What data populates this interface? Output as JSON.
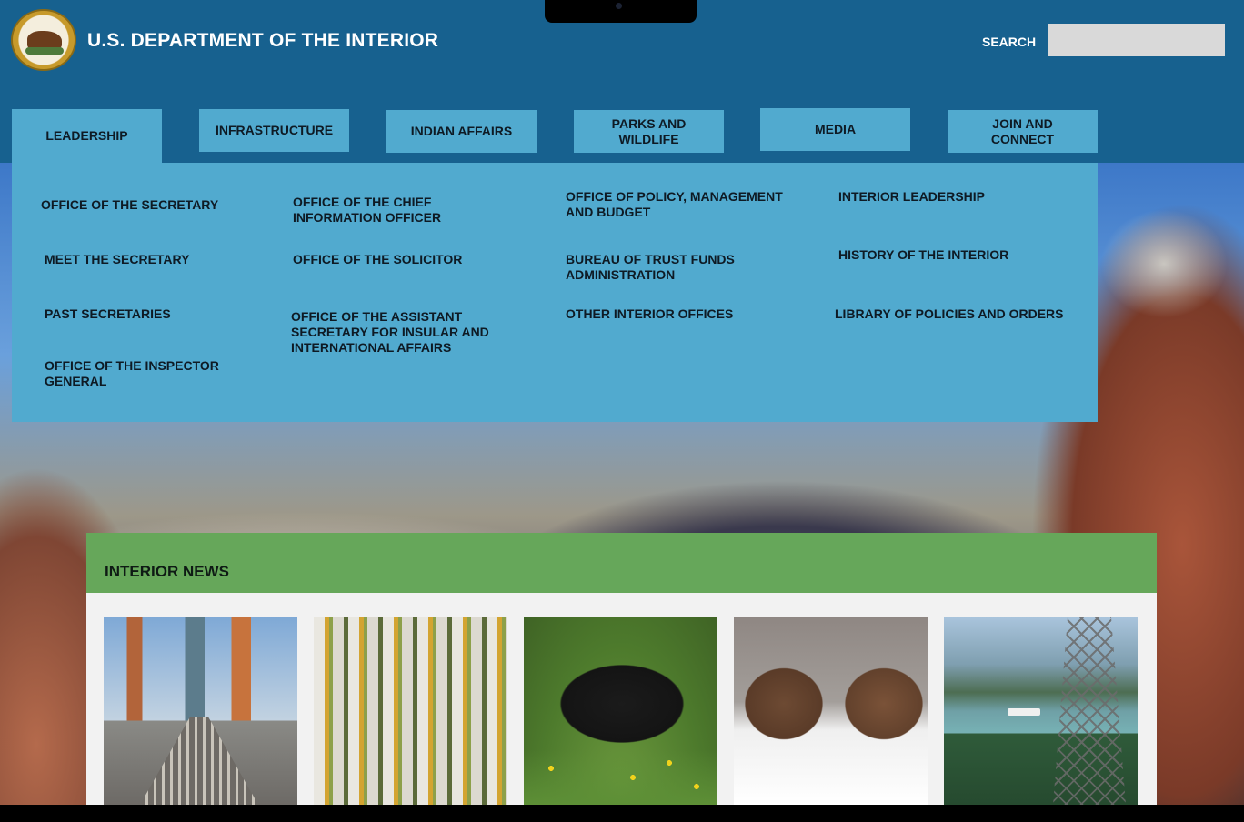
{
  "header": {
    "title": "U.S. DEPARTMENT OF THE INTERIOR",
    "search_label": "SEARCH",
    "search_value": "",
    "seal_icon": "doi-seal-bison-icon",
    "background_color": "#17618f"
  },
  "nav": {
    "tabs": [
      {
        "label": "LEADERSHIP",
        "active": true
      },
      {
        "label": "INFRASTRUCTURE",
        "active": false
      },
      {
        "label": "INDIAN AFFAIRS",
        "active": false
      },
      {
        "label": "PARKS AND WILDLIFE",
        "active": false
      },
      {
        "label": "MEDIA",
        "active": false
      },
      {
        "label": "JOIN AND CONNECT",
        "active": false
      }
    ],
    "tab_color": "#51aacf"
  },
  "dropdown": {
    "columns": [
      [
        "OFFICE OF THE SECRETARY",
        "MEET THE SECRETARY",
        "PAST SECRETARIES",
        "OFFICE OF THE INSPECTOR GENERAL"
      ],
      [
        "OFFICE OF THE CHIEF INFORMATION OFFICER",
        "OFFICE OF THE SOLICITOR",
        "OFFICE OF THE ASSISTANT SECRETARY FOR INSULAR AND INTERNATIONAL AFFAIRS"
      ],
      [
        "OFFICE OF POLICY, MANAGEMENT AND BUDGET",
        "BUREAU OF TRUST FUNDS ADMINISTRATION",
        "OTHER INTERIOR OFFICES"
      ],
      [
        "INTERIOR LEADERSHIP",
        "HISTORY OF THE INTERIOR",
        "LIBRARY OF POLICIES AND ORDERS"
      ]
    ]
  },
  "news": {
    "title": "INTERIOR NEWS",
    "header_color": "#66a75a",
    "cards": [
      {
        "image": "city-rail-yard-image"
      },
      {
        "image": "aspen-forest-image"
      },
      {
        "image": "black-bear-image"
      },
      {
        "image": "sparring-elk-image"
      },
      {
        "image": "alaska-harbor-tower-image"
      }
    ]
  }
}
